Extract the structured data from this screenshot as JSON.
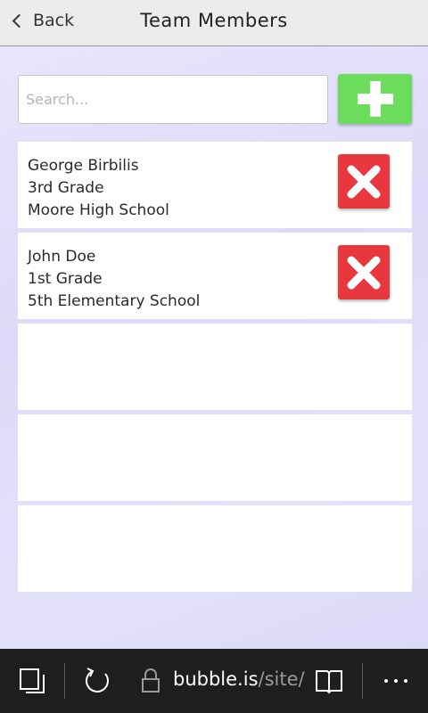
{
  "header": {
    "back_label": "Back",
    "title": "Team Members"
  },
  "search": {
    "placeholder": "Search..."
  },
  "members": [
    {
      "name": "George Birbilis",
      "grade": "3rd Grade",
      "school": "Moore High School"
    },
    {
      "name": "John Doe",
      "grade": "1st Grade",
      "school": "5th Elementary School"
    }
  ],
  "browser": {
    "url_host": "bubble.is",
    "url_path": "/site/"
  },
  "icons": {
    "add": "plus-icon",
    "delete": "x-icon",
    "back": "chevron-left-icon",
    "tabs": "tabs-icon",
    "refresh": "refresh-icon",
    "lock": "lock-icon",
    "reading": "book-icon",
    "more": "more-icon"
  },
  "colors": {
    "add_button": "#6bdc5b",
    "delete_button": "#e8383d",
    "browser_bar": "#1e1e1e"
  }
}
